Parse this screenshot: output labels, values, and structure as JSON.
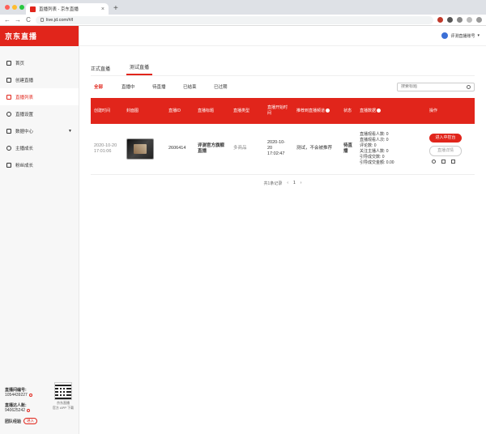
{
  "browser": {
    "tab_title": "直播列表 - 京东直播",
    "tab_close": "×",
    "new_tab": "+",
    "url": "live.jd.com/#/l",
    "back": "←",
    "forward": "→",
    "reload": "C"
  },
  "sidebar": {
    "logo": "京东直播",
    "items": [
      {
        "label": "首页"
      },
      {
        "label": "创建直播"
      },
      {
        "label": "直播列表"
      },
      {
        "label": "直播设置"
      },
      {
        "label": "数据中心"
      },
      {
        "label": "主播成长"
      },
      {
        "label": "粉丝成长"
      }
    ],
    "account_label": "直播间编号:",
    "account_value": "1054439227",
    "talent_label": "直播达人账:",
    "talent_value": "940625242",
    "org_label": "团队经验",
    "enter_label": "进入",
    "qr_caption_1": "京东直播",
    "qr_caption_2": "官方 APP 下载"
  },
  "header": {
    "user_name": "评测直播账号"
  },
  "main": {
    "tabs": [
      {
        "label": "正式直播"
      },
      {
        "label": "测试直播"
      }
    ],
    "filters": [
      "全部",
      "直播中",
      "待直播",
      "已结束",
      "已过期"
    ],
    "search_placeholder": "搜索标题",
    "table": {
      "headers": [
        "创建时间",
        "封面图",
        "直播ID",
        "直播标题",
        "直播类型",
        "直播开始时间",
        "推荐到直播频道",
        "状态",
        "直播数据",
        "操作"
      ],
      "rows": [
        {
          "created": "2020-10-20 17:01:06",
          "id": "2606414",
          "title": "评测官方旗舰直播",
          "type": "多商品",
          "start_time": "2020-10-20 17:02:47",
          "recommend": "测试，不会被推荐",
          "status": "待直播",
          "stats": [
            "直播观看人数: 0",
            "直播观看人次: 0",
            "评论数: 0",
            "关注主播人数: 0",
            "引导成交数: 0",
            "引导成交金额: 0.00"
          ],
          "primary_action": "进入中控台",
          "secondary_action": "直播详情"
        }
      ]
    },
    "pagination": {
      "total": "共1条记录",
      "prev": "‹",
      "page": "1",
      "next": "›"
    }
  }
}
